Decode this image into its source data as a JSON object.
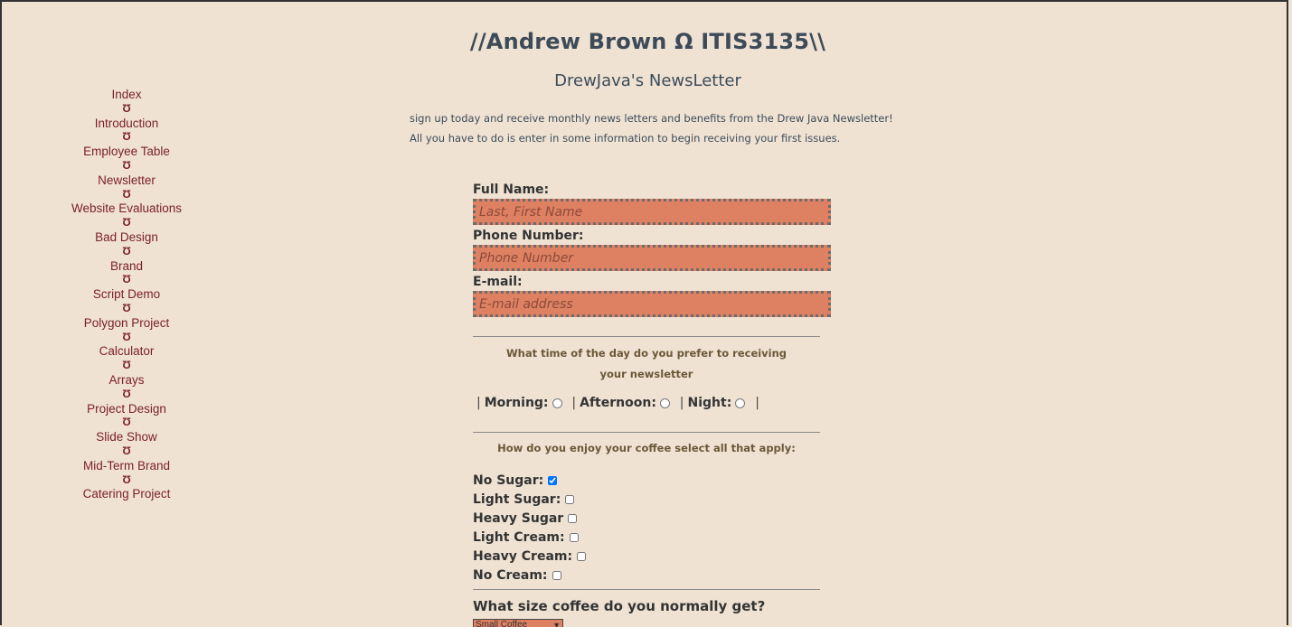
{
  "header": {
    "title": "//Andrew Brown Ω ITIS3135\\\\",
    "subtitle": "DrewJava's NewsLetter"
  },
  "intro": {
    "line1": "sign up today and receive monthly news letters and benefits from the Drew Java Newsletter!",
    "line2": "All you have to do is enter in some information to begin receiving your first issues."
  },
  "sidebar": {
    "separator": "Ʊ",
    "items": [
      {
        "label": "Index"
      },
      {
        "label": "Introduction"
      },
      {
        "label": "Employee Table"
      },
      {
        "label": "Newsletter"
      },
      {
        "label": "Website Evaluations"
      },
      {
        "label": "Bad Design"
      },
      {
        "label": "Brand"
      },
      {
        "label": "Script Demo"
      },
      {
        "label": "Polygon Project"
      },
      {
        "label": "Calculator"
      },
      {
        "label": "Arrays"
      },
      {
        "label": "Project Design"
      },
      {
        "label": "Slide Show"
      },
      {
        "label": "Mid-Term Brand"
      },
      {
        "label": "Catering Project"
      }
    ]
  },
  "form": {
    "full_name": {
      "label": "Full Name:",
      "placeholder": "Last, First Name",
      "value": ""
    },
    "phone": {
      "label": "Phone Number:",
      "placeholder": "Phone Number",
      "value": ""
    },
    "email": {
      "label": "E-mail:",
      "placeholder": "E-mail address",
      "value": ""
    },
    "time_question_line1": "What time of the day do you prefer to receiving",
    "time_question_line2": "your newsletter",
    "time_options": {
      "sep": "|",
      "morning": "Morning:",
      "afternoon": "Afternoon:",
      "night": "Night:"
    },
    "coffee_question": "How do you enjoy your coffee select all that apply:",
    "coffee_options": [
      {
        "label": "No Sugar:",
        "checked": true
      },
      {
        "label": "Light Sugar:",
        "checked": false
      },
      {
        "label": "Heavy Sugar",
        "checked": false
      },
      {
        "label": "Light Cream:",
        "checked": false
      },
      {
        "label": "Heavy Cream:",
        "checked": false
      },
      {
        "label": "No Cream:",
        "checked": false
      }
    ],
    "size_question": "What size coffee do you normally get?",
    "size_selected": "Small Coffee"
  }
}
